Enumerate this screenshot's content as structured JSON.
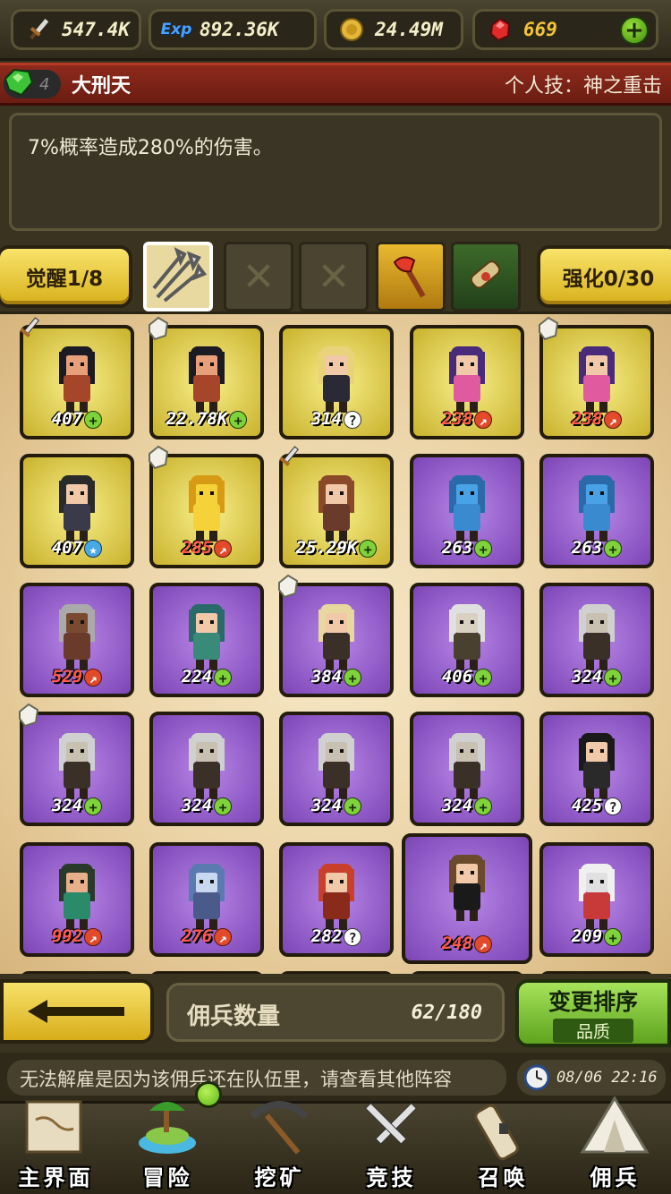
{
  "resources": {
    "attack": "547.4K",
    "exp_icon_text": "Exp",
    "exp": "892.36K",
    "gold": "24.49M",
    "gems": "669"
  },
  "hero": {
    "rank": "4",
    "name": "大刑天",
    "skill": "个人技：神之重击",
    "description": "7%概率造成280%的伤害。"
  },
  "awaken": {
    "label": "觉醒1/8",
    "enhance_label": "强化0/30"
  },
  "heroes": [
    {
      "level": "407",
      "badge": "plus",
      "frame": "gold",
      "corner": "sword",
      "skin": "#e8a07a",
      "hair": "#1c1a22",
      "outfit": "#a5452a"
    },
    {
      "level": "22.78K",
      "badge": "plus",
      "frame": "gold",
      "corner": "crystal",
      "skin": "#e8a07a",
      "hair": "#1c1a22",
      "outfit": "#a5452a"
    },
    {
      "level": "314",
      "badge": "q",
      "frame": "gold",
      "corner": "",
      "skin": "#f1c8a8",
      "hair": "#e8d27a",
      "outfit": "#2a2a36"
    },
    {
      "level": "238",
      "badge": "up",
      "frame": "gold",
      "corner": "",
      "skin": "#f1c8a8",
      "hair": "#4a2a7a",
      "outfit": "#e05aa0"
    },
    {
      "level": "238",
      "badge": "up",
      "frame": "gold",
      "corner": "crystal",
      "skin": "#f1c8a8",
      "hair": "#4a2a7a",
      "outfit": "#e05aa0"
    },
    {
      "level": "407",
      "badge": "star",
      "frame": "gold",
      "corner": "",
      "skin": "#f1c8a8",
      "hair": "#2a2a2a",
      "outfit": "#3a3a4a"
    },
    {
      "level": "285",
      "badge": "up",
      "frame": "gold",
      "corner": "crystal",
      "skin": "#f5d23a",
      "hair": "#d69a14",
      "outfit": "#f5d23a"
    },
    {
      "level": "25.29K",
      "badge": "plus",
      "frame": "gold",
      "corner": "sword",
      "skin": "#f1c8a8",
      "hair": "#8a4a2a",
      "outfit": "#6a3a2a"
    },
    {
      "level": "263",
      "badge": "plus",
      "frame": "purple",
      "corner": "",
      "skin": "#4aa2e6",
      "hair": "#2a6aa8",
      "outfit": "#3a8ad0"
    },
    {
      "level": "263",
      "badge": "plus",
      "frame": "purple",
      "corner": "",
      "skin": "#4aa2e6",
      "hair": "#2a6aa8",
      "outfit": "#3a8ad0"
    },
    {
      "level": "529",
      "badge": "up",
      "frame": "purple",
      "corner": "",
      "skin": "#7a4a30",
      "hair": "#aaaaaa",
      "outfit": "#6a3a2a"
    },
    {
      "level": "224",
      "badge": "plus",
      "frame": "purple",
      "corner": "",
      "skin": "#f1c8a8",
      "hair": "#2a6a6a",
      "outfit": "#3a8a7a"
    },
    {
      "level": "384",
      "badge": "plus",
      "frame": "purple",
      "corner": "crystal",
      "skin": "#f1c8a8",
      "hair": "#e8d8a0",
      "outfit": "#3a3028"
    },
    {
      "level": "406",
      "badge": "plus",
      "frame": "purple",
      "corner": "",
      "skin": "#d8d0c0",
      "hair": "#e0e0e0",
      "outfit": "#4a4030"
    },
    {
      "level": "324",
      "badge": "plus",
      "frame": "purple",
      "corner": "",
      "skin": "#c8c0b0",
      "hair": "#d0d0d0",
      "outfit": "#3a3028"
    },
    {
      "level": "324",
      "badge": "plus",
      "frame": "purple",
      "corner": "crystal",
      "skin": "#c8c0b0",
      "hair": "#d0d0d0",
      "outfit": "#3a3028"
    },
    {
      "level": "324",
      "badge": "plus",
      "frame": "purple",
      "corner": "",
      "skin": "#c8c0b0",
      "hair": "#d0d0d0",
      "outfit": "#3a3028"
    },
    {
      "level": "324",
      "badge": "plus",
      "frame": "purple",
      "corner": "",
      "skin": "#c8c0b0",
      "hair": "#d0d0d0",
      "outfit": "#3a3028"
    },
    {
      "level": "324",
      "badge": "plus",
      "frame": "purple",
      "corner": "",
      "skin": "#c8c0b0",
      "hair": "#d0d0d0",
      "outfit": "#3a3028"
    },
    {
      "level": "425",
      "badge": "q",
      "frame": "purple",
      "corner": "",
      "skin": "#f1c8a8",
      "hair": "#1a1a1a",
      "outfit": "#2a2a2a"
    },
    {
      "level": "992",
      "badge": "up",
      "frame": "purple",
      "corner": "",
      "skin": "#e8b08a",
      "hair": "#2a3a2a",
      "outfit": "#2a8a6a"
    },
    {
      "level": "276",
      "badge": "up",
      "frame": "purple",
      "corner": "",
      "skin": "#c8d8f0",
      "hair": "#5a7ab0",
      "outfit": "#4a5a8a"
    },
    {
      "level": "282",
      "badge": "q",
      "frame": "purple",
      "corner": "",
      "skin": "#f1c8a8",
      "hair": "#c8402a",
      "outfit": "#8a2a1a"
    },
    {
      "level": "248",
      "badge": "up",
      "frame": "purple",
      "corner": "",
      "skin": "#f1c8a8",
      "hair": "#6a4a2a",
      "outfit": "#1a1a1a",
      "big": true
    },
    {
      "level": "209",
      "badge": "plus",
      "frame": "purple",
      "corner": "",
      "skin": "#e0e0e0",
      "hair": "#f0f0f0",
      "outfit": "#c83a3a"
    }
  ],
  "controls": {
    "count_label": "佣兵数量",
    "count_value": "62/180",
    "sort_title": "变更排序",
    "sort_sub": "品质"
  },
  "message": "无法解雇是因为该佣兵还在队伍里，请查看其他阵容",
  "clock": "08/06 22:16",
  "nav": [
    {
      "label": "主界面",
      "icon": "map-scroll-icon"
    },
    {
      "label": "冒险",
      "icon": "island-icon"
    },
    {
      "label": "挖矿",
      "icon": "pickaxe-icon"
    },
    {
      "label": "竞技",
      "icon": "crossed-swords-icon"
    },
    {
      "label": "召唤",
      "icon": "summon-scroll-icon"
    },
    {
      "label": "佣兵",
      "icon": "tent-icon"
    }
  ]
}
